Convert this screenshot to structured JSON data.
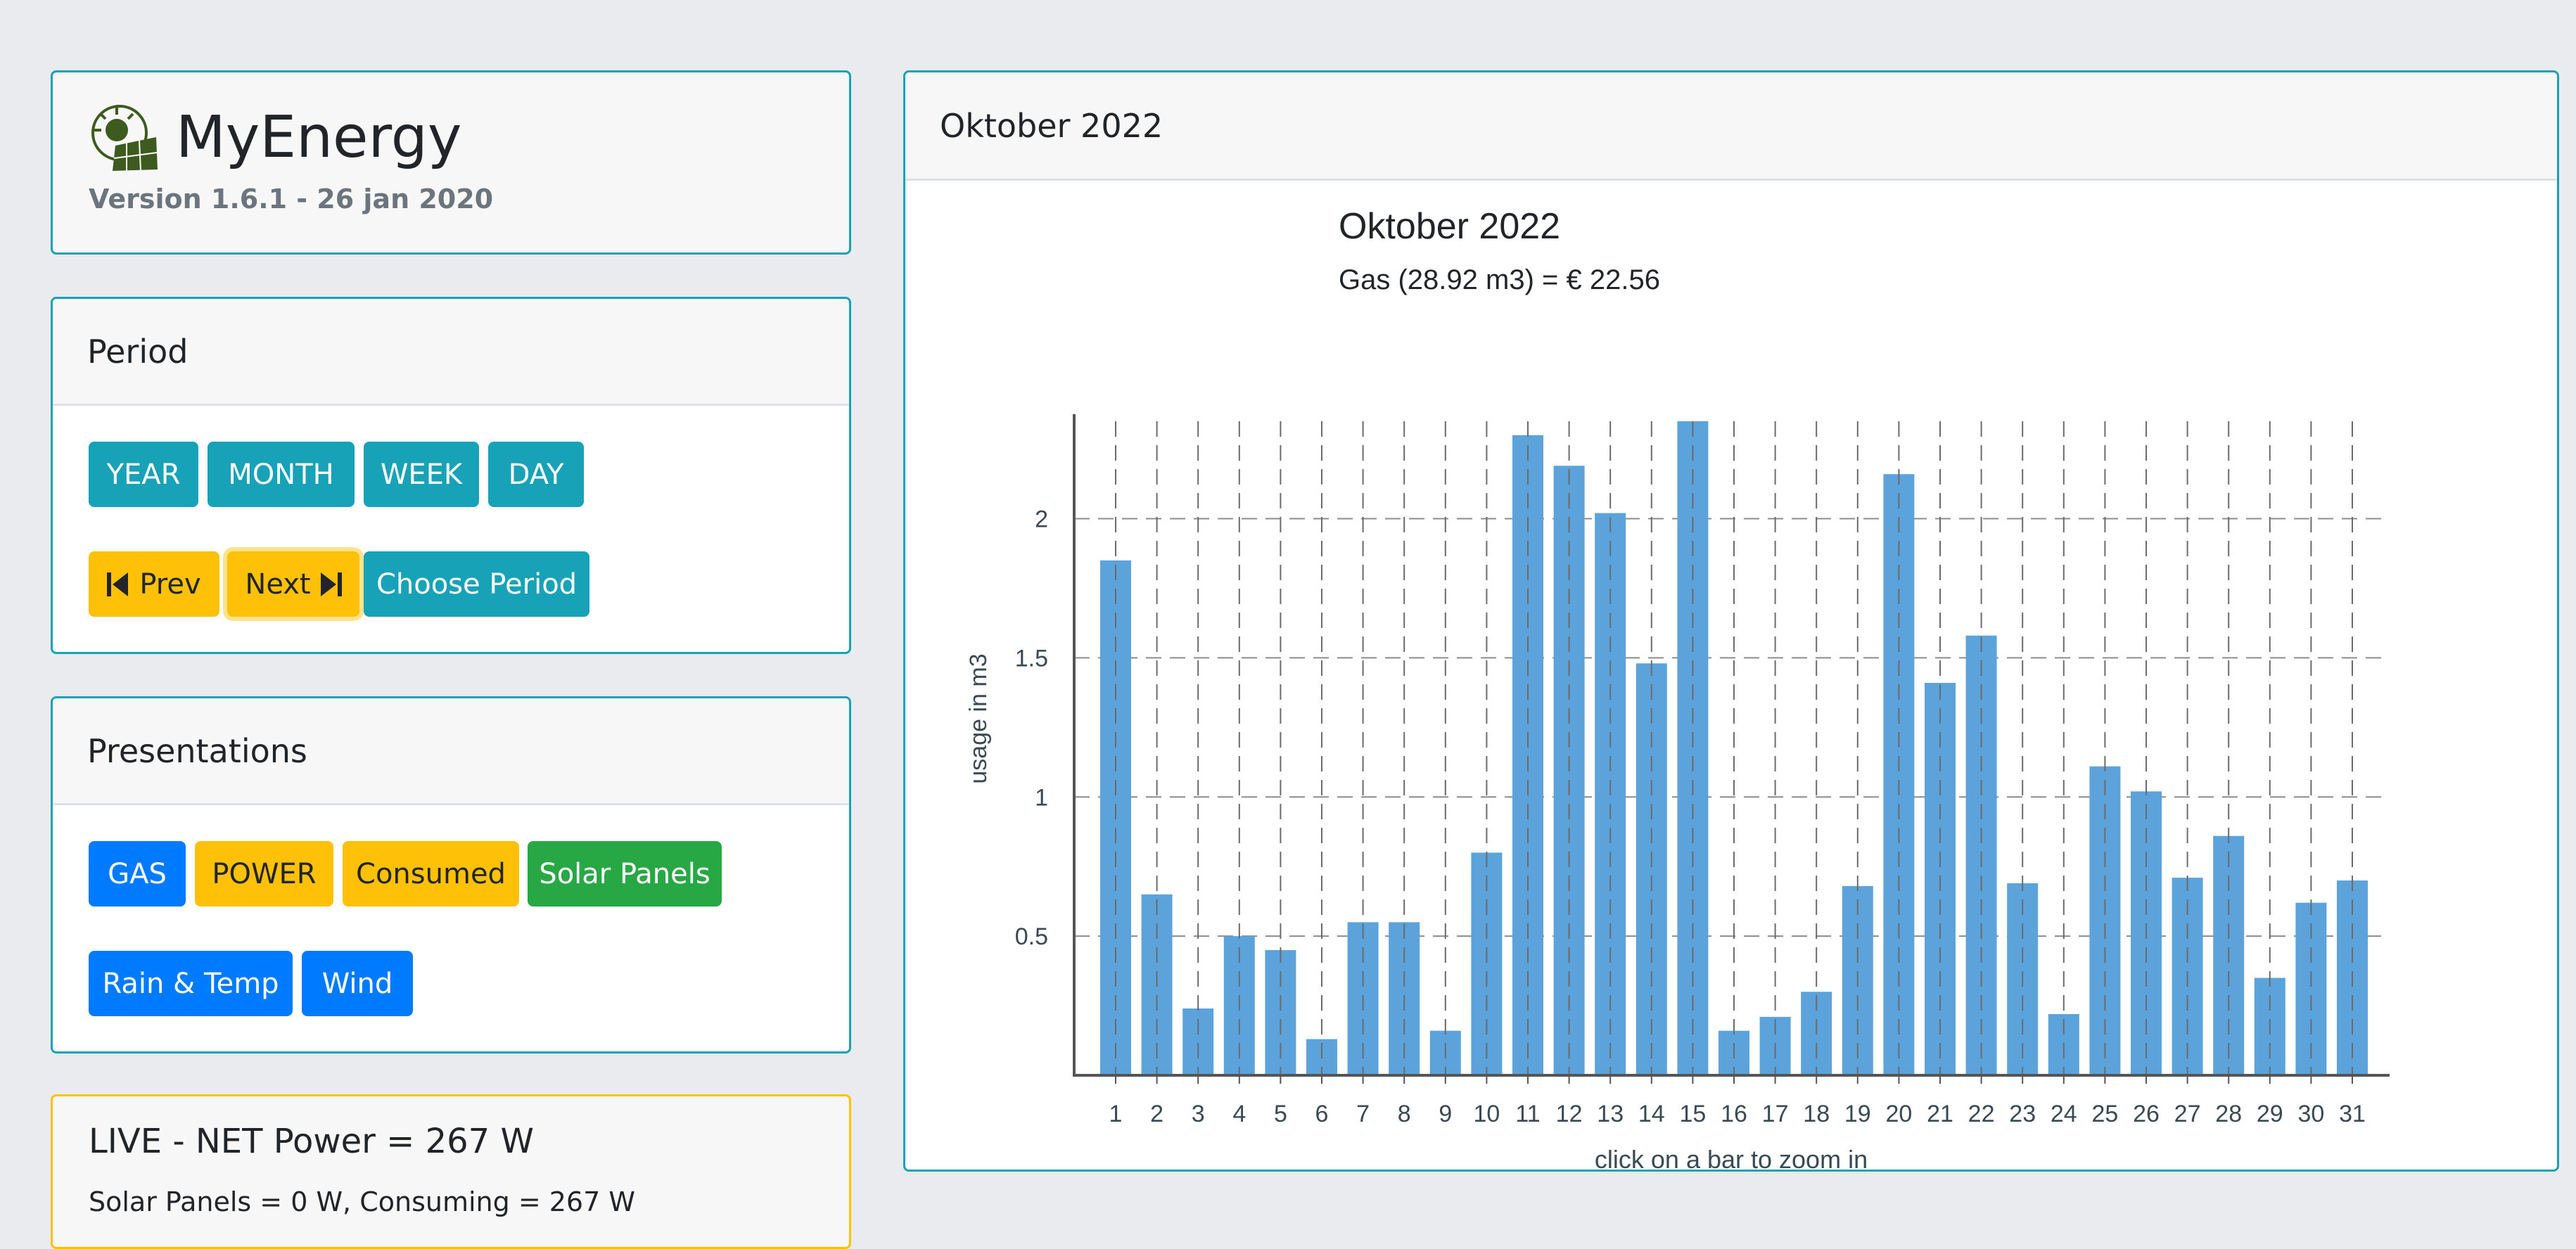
{
  "brand": {
    "title": "MyEnergy",
    "version": "Version 1.6.1 - 26 jan 2020"
  },
  "period": {
    "header": "Period",
    "buttons": [
      "YEAR",
      "MONTH",
      "WEEK",
      "DAY"
    ],
    "prev": "Prev",
    "next": "Next",
    "choose": "Choose Period"
  },
  "presentations": {
    "header": "Presentations",
    "gas": "GAS",
    "power": "POWER",
    "consumed": "Consumed",
    "solar": "Solar Panels",
    "rain": "Rain & Temp",
    "wind": "Wind"
  },
  "live": {
    "title": "LIVE - NET Power = 267 W",
    "detail": "Solar Panels = 0 W, Consuming = 267 W"
  },
  "chart_card": {
    "header": "Oktober 2022"
  },
  "colors": {
    "bar": "#5ca3dc",
    "accent": "#17a2b8",
    "warning": "#ffc107",
    "primary": "#007bff",
    "success": "#28a745"
  },
  "chart_data": {
    "type": "bar",
    "title": "Oktober 2022",
    "subtitle": "Gas (28.92 m3) = € 22.56",
    "xlabel": "click on a bar to zoom in",
    "ylabel": "usage in m3",
    "categories": [
      "1",
      "2",
      "3",
      "4",
      "5",
      "6",
      "7",
      "8",
      "9",
      "10",
      "11",
      "12",
      "13",
      "14",
      "15",
      "16",
      "17",
      "18",
      "19",
      "20",
      "21",
      "22",
      "23",
      "24",
      "25",
      "26",
      "27",
      "28",
      "29",
      "30",
      "31"
    ],
    "values": [
      1.85,
      0.65,
      0.24,
      0.5,
      0.45,
      0.13,
      0.55,
      0.55,
      0.16,
      0.8,
      2.3,
      2.19,
      2.02,
      1.48,
      2.35,
      0.16,
      0.21,
      0.3,
      0.68,
      2.16,
      1.41,
      1.58,
      0.69,
      0.22,
      1.11,
      1.02,
      0.71,
      0.86,
      0.35,
      0.62,
      0.7
    ],
    "yticks": [
      "0.5",
      "1",
      "1.5",
      "2"
    ],
    "ylim": [
      0,
      2.35
    ],
    "grid": true
  }
}
